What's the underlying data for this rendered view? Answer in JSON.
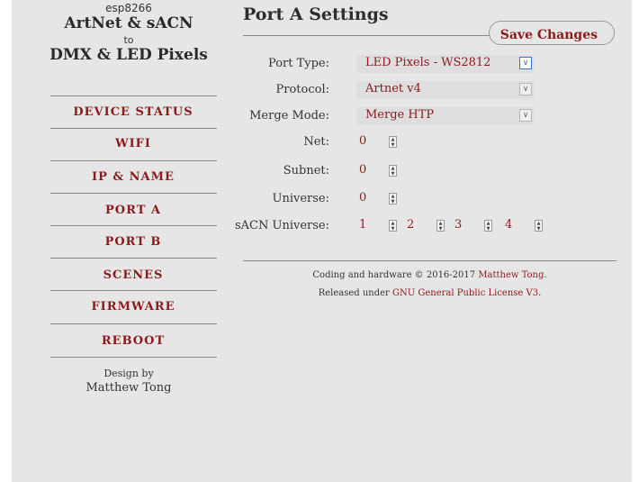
{
  "brand": {
    "device": "esp8266",
    "title": "ArtNet & sACN",
    "to": "to",
    "subtitle": "DMX & LED Pixels"
  },
  "nav": {
    "items": [
      {
        "label": "DEVICE STATUS"
      },
      {
        "label": "WIFI"
      },
      {
        "label": "IP & NAME"
      },
      {
        "label": "PORT A"
      },
      {
        "label": "PORT B"
      },
      {
        "label": "SCENES"
      },
      {
        "label": "FIRMWARE"
      },
      {
        "label": "REBOOT"
      }
    ]
  },
  "design": {
    "line1": "Design by",
    "line2": "Matthew Tong"
  },
  "page": {
    "title": "Port A Settings",
    "save_label": "Save Changes"
  },
  "fields": {
    "port_type": {
      "label": "Port Type:",
      "value": "LED Pixels - WS2812"
    },
    "protocol": {
      "label": "Protocol:",
      "value": "Artnet v4"
    },
    "merge_mode": {
      "label": "Merge Mode:",
      "value": "Merge HTP"
    },
    "net": {
      "label": "Net:",
      "value": "0"
    },
    "subnet": {
      "label": "Subnet:",
      "value": "0"
    },
    "universe": {
      "label": "Universe:",
      "value": "0"
    },
    "sacn": {
      "label": "sACN Universe:",
      "values": [
        "1",
        "2",
        "3",
        "4"
      ]
    }
  },
  "footer": {
    "line1_prefix": "Coding and hardware © 2016-2017 ",
    "line1_link": "Matthew Tong",
    "line1_suffix": ".",
    "line2_prefix": "Released under ",
    "line2_link": "GNU General Public License V3",
    "line2_suffix": "."
  },
  "colors": {
    "accent": "#8b1a1a",
    "panel_bg": "#e6e6e6",
    "focus": "#3b73c9"
  }
}
